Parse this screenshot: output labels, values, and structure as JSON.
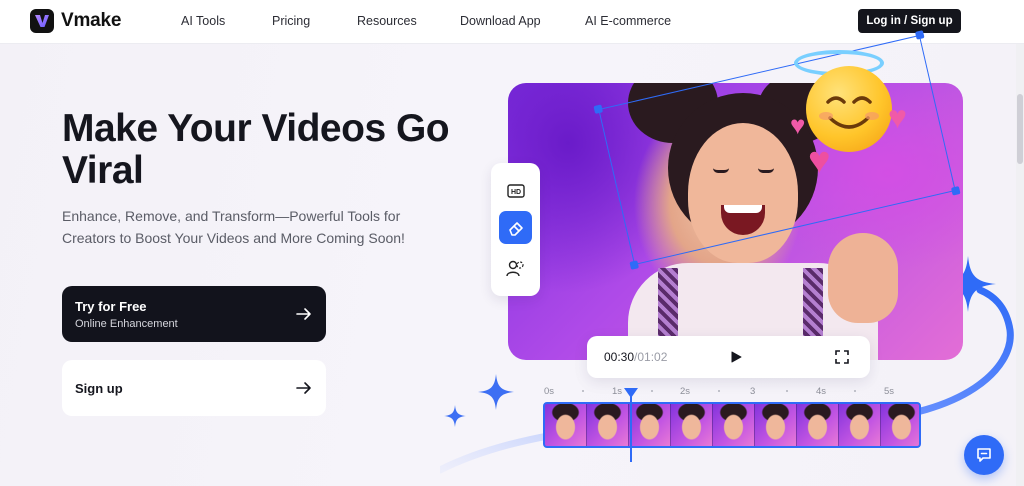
{
  "brand": {
    "name": "Vmake",
    "accent": "#2f6bf7",
    "dark": "#12131c"
  },
  "nav": {
    "items": [
      {
        "label": "AI Tools"
      },
      {
        "label": "Pricing"
      },
      {
        "label": "Resources"
      },
      {
        "label": "Download App"
      },
      {
        "label": "AI E-commerce"
      }
    ],
    "login_label": "Log in / Sign up"
  },
  "hero": {
    "title": "Make Your Videos Go Viral",
    "subtitle": "Enhance, Remove, and Transform—Powerful Tools for Creators to Boost Your Videos and More Coming Soon!",
    "primary_button": {
      "label": "Try for Free",
      "sublabel": "Online Enhancement"
    },
    "secondary_button": {
      "label": "Sign up"
    }
  },
  "editor": {
    "tools": [
      {
        "icon": "hd-icon",
        "active": false
      },
      {
        "icon": "eraser-icon",
        "active": true
      },
      {
        "icon": "person-remove-icon",
        "active": false
      }
    ],
    "player": {
      "current_time": "00:30",
      "separator": "/",
      "duration": "01:02",
      "play_icon": "play-icon",
      "fullscreen_icon": "fullscreen-icon"
    },
    "timeline": {
      "labels": [
        "0s",
        "1s",
        "2s",
        "3",
        "4s",
        "5s"
      ],
      "frame_count": 9
    }
  },
  "support": {
    "chat_icon": "chat-icon"
  }
}
